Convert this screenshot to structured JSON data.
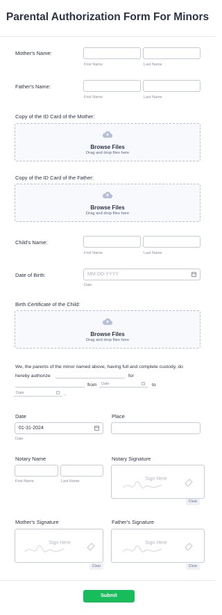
{
  "form": {
    "title": "Parental Authorization Form For Minors",
    "mother_name": {
      "label": "Mother's Name:",
      "first": "First Name",
      "last": "Last Name"
    },
    "father_name": {
      "label": "Father's Name:",
      "first": "First Name",
      "last": "Last Name"
    },
    "id_mother": {
      "label": "Copy of the ID Card of the Mother:",
      "browse": "Browse Files",
      "drag": "Drag and drop files here"
    },
    "id_father": {
      "label": "Copy of the ID Card of the Father:",
      "browse": "Browse Files",
      "drag": "Drag and drop files here"
    },
    "child_name": {
      "label": "Child's Name:",
      "first": "First Name",
      "last": "Last Name"
    },
    "dob": {
      "label": "Date of Birth:",
      "placeholder": "MM-DD-YYYY",
      "sub": "Date"
    },
    "birth_cert": {
      "label": "Birth Certificate of the Child:",
      "browse": "Browse Files",
      "drag": "Drag and drop files here"
    },
    "statement": {
      "line1": "We, the parents of the minor named above, having full and complete custody, do",
      "hereby": "hereby authorize",
      "for": "for",
      "from": "from",
      "date_ph": "Date",
      "to": "to",
      "period": "."
    },
    "date": {
      "label": "Date",
      "value": "01-31-2024",
      "sub": "Date"
    },
    "place": {
      "label": "Place"
    },
    "notary_name": {
      "label": "Notary Name",
      "first": "First Name",
      "last": "Last Name"
    },
    "notary_signature": {
      "label": "Notary Signature",
      "sign_here": "Sign Here",
      "clear": "Clear"
    },
    "mother_signature": {
      "label": "Mother's Signature",
      "sign_here": "Sign Here",
      "clear": "Clear"
    },
    "father_signature": {
      "label": "Father's Signature",
      "sign_here": "Sign Here",
      "clear": "Clear"
    },
    "submit": "Submit"
  },
  "colors": {
    "accent": "#18bd5b",
    "text": "#2c3345",
    "border": "#c3cad8",
    "muted": "#8d8fa8"
  }
}
